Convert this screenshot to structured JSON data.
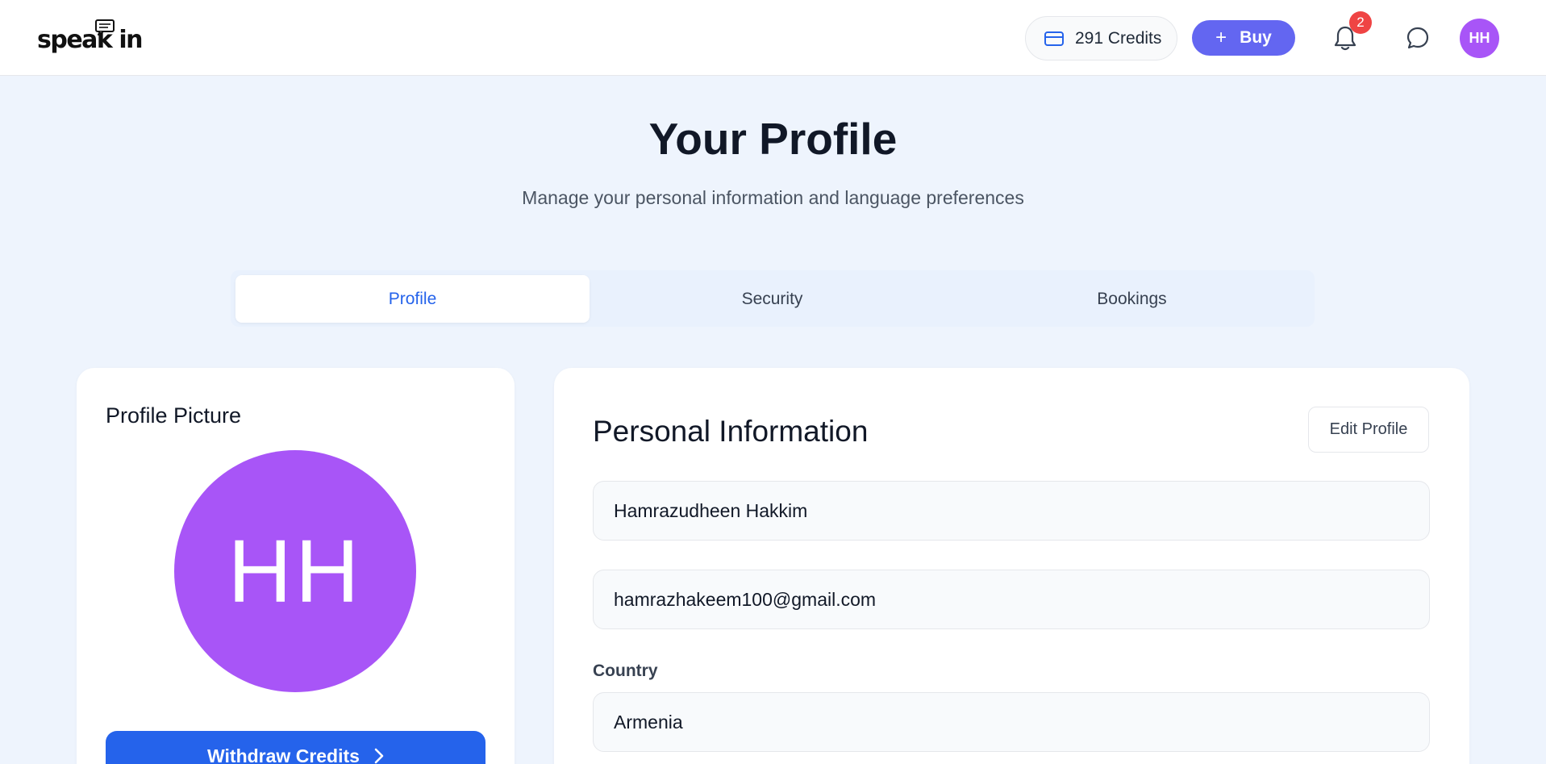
{
  "header": {
    "logo_text": "speak in",
    "credits_label": "291 Credits",
    "buy_label": "Buy",
    "notification_count": "2",
    "avatar_initials": "HH",
    "icons": [
      "credit-card-icon",
      "plus-icon",
      "bell-icon",
      "chat-icon"
    ]
  },
  "page": {
    "title": "Your Profile",
    "subtitle": "Manage your personal information and language preferences"
  },
  "tabs": [
    {
      "label": "Profile",
      "active": true
    },
    {
      "label": "Security",
      "active": false
    },
    {
      "label": "Bookings",
      "active": false
    }
  ],
  "profile_picture": {
    "title": "Profile Picture",
    "initials": "HH",
    "withdraw_label": "Withdraw Credits"
  },
  "personal_info": {
    "title": "Personal Information",
    "edit_label": "Edit Profile",
    "name": "Hamrazudheen Hakkim",
    "email": "hamrazhakeem100@gmail.com",
    "country_label": "Country",
    "country": "Armenia"
  },
  "colors": {
    "accent_blue": "#2563eb",
    "buy_indigo": "#6366f1",
    "avatar_purple": "#a855f7",
    "badge_red": "#ef4444",
    "page_bg": "#eef4fd"
  }
}
